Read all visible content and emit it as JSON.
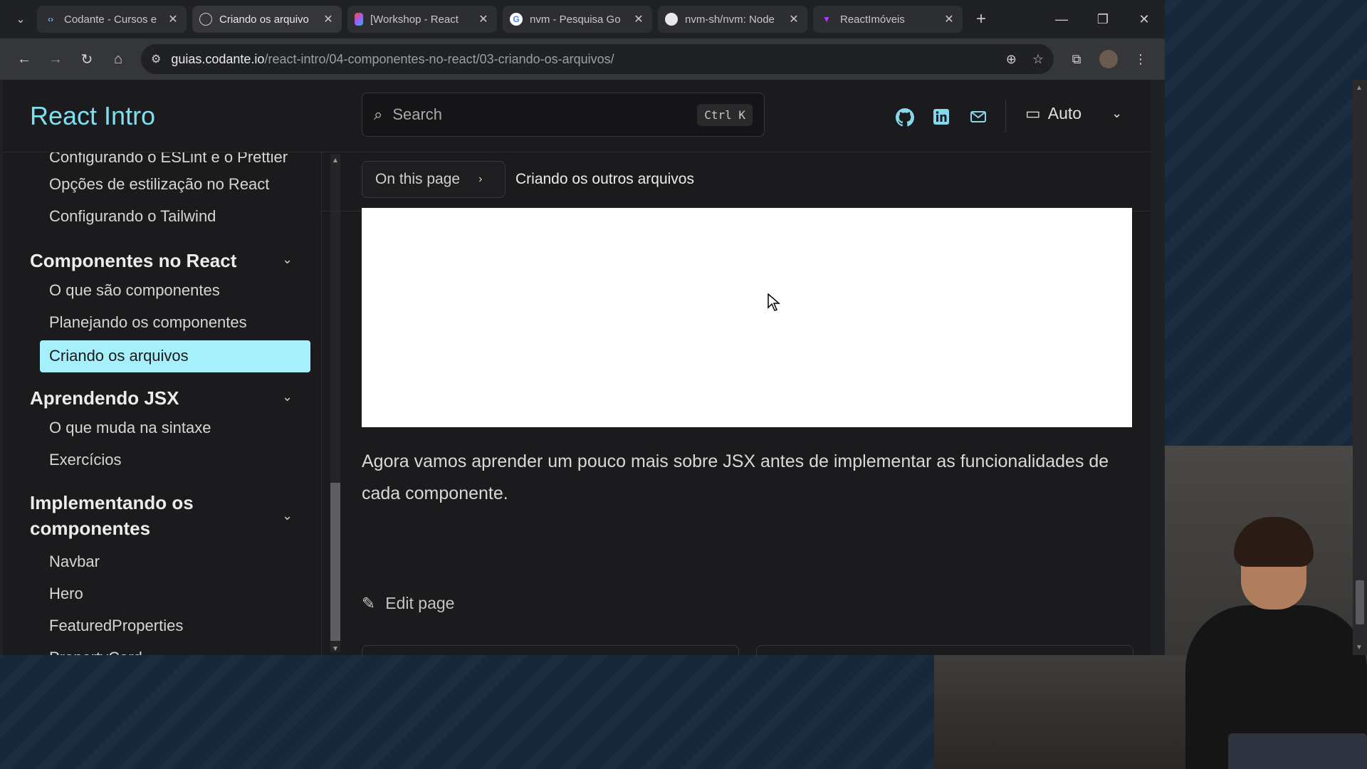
{
  "browser": {
    "tabs": [
      {
        "title": "Codante - Cursos e",
        "favicon": "code-icon",
        "active": false
      },
      {
        "title": "Criando os arquivo",
        "favicon": "globe-icon",
        "active": true
      },
      {
        "title": "[Workshop - React",
        "favicon": "figma-icon",
        "active": false
      },
      {
        "title": "nvm - Pesquisa Go",
        "favicon": "google-icon",
        "active": false
      },
      {
        "title": "nvm-sh/nvm: Node",
        "favicon": "github-icon",
        "active": false
      },
      {
        "title": "ReactImóveis",
        "favicon": "vite-icon",
        "active": false
      }
    ],
    "new_tab_label": "+",
    "url_host": "guias.codante.io",
    "url_path": "/react-intro/04-componentes-no-react/03-criando-os-arquivos/"
  },
  "header": {
    "site_title": "React Intro",
    "search_placeholder": "Search",
    "search_shortcut": "Ctrl K",
    "theme_label": "Auto"
  },
  "sidebar": {
    "partial_link": "Configurando o ESLint e o Prettier",
    "links_top": [
      "Opções de estilização no React",
      "Configurando o Tailwind"
    ],
    "groups": [
      {
        "title": "Componentes no React",
        "items": [
          "O que são componentes",
          "Planejando os componentes",
          "Criando os arquivos"
        ]
      },
      {
        "title": "Aprendendo JSX",
        "items": [
          "O que muda na sintaxe",
          "Exercícios"
        ]
      },
      {
        "title_line1": "Implementando os",
        "title_line2": "componentes",
        "items": [
          "Navbar",
          "Hero",
          "FeaturedProperties",
          "PropertyCard"
        ]
      }
    ],
    "active_item": "Criando os arquivos"
  },
  "content": {
    "on_this_page_label": "On this page",
    "current_heading": "Criando os outros arquivos",
    "paragraph": "Agora vamos aprender um pouco mais sobre JSX antes de implementar as funcionalidades de cada componente.",
    "edit_page_label": "Edit page"
  },
  "colors": {
    "accent": "#7ee0ef",
    "active_item_bg": "#a5f0fb",
    "page_bg": "#1b1b1d"
  }
}
